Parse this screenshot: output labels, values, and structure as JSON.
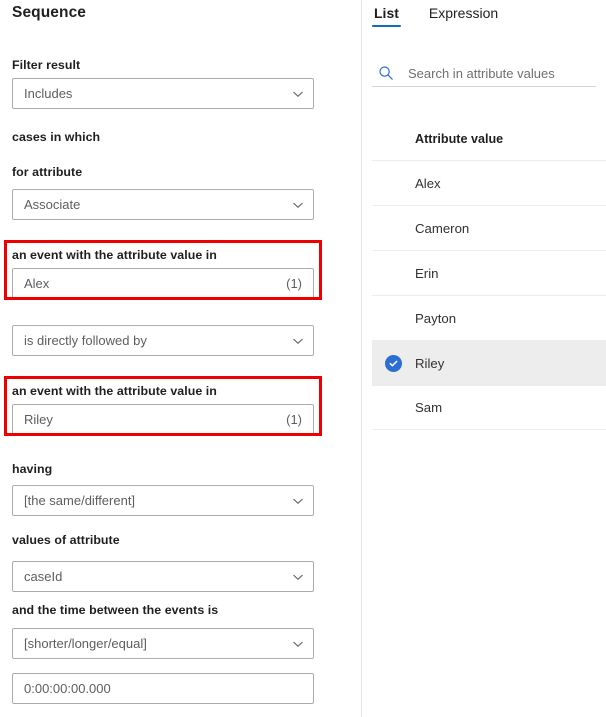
{
  "left": {
    "title": "Sequence",
    "fields": [
      {
        "label": "Filter result",
        "value": "Includes",
        "type": "select"
      },
      {
        "label": "cases in which",
        "type": "label-only"
      },
      {
        "label": "for attribute",
        "value": "Associate",
        "type": "select"
      },
      {
        "label": "an event with the attribute value in",
        "value": "Alex",
        "count": "(1)",
        "type": "input",
        "highlight": true
      },
      {
        "label": "",
        "value": "is directly followed by",
        "type": "select"
      },
      {
        "label": "an event with the attribute value in",
        "value": "Riley",
        "count": "(1)",
        "type": "input",
        "highlight": true
      },
      {
        "label": "having",
        "value": "[the same/different]",
        "type": "select"
      },
      {
        "label": "values of attribute",
        "value": "caseId",
        "type": "select"
      },
      {
        "label": "and the time between the events is",
        "value": "[shorter/longer/equal]",
        "type": "select"
      },
      {
        "label": "",
        "value": "0:00:00:00.000",
        "type": "input"
      }
    ],
    "highlight_color": "#ee0000",
    "chevron_icon": "chevron-down-icon"
  },
  "right": {
    "tabs": [
      {
        "label": "List",
        "active": true
      },
      {
        "label": "Expression",
        "active": false
      }
    ],
    "accent_color": "#0f6cbd",
    "search": {
      "placeholder": "Search in attribute values",
      "value": "",
      "icon": "search-icon"
    },
    "list_header": "Attribute value",
    "items": [
      {
        "label": "Alex",
        "selected": false
      },
      {
        "label": "Cameron",
        "selected": false
      },
      {
        "label": "Erin",
        "selected": false
      },
      {
        "label": "Payton",
        "selected": false
      },
      {
        "label": "Riley",
        "selected": true
      },
      {
        "label": "Sam",
        "selected": false
      }
    ],
    "selected_color": "#2b6fd4"
  }
}
